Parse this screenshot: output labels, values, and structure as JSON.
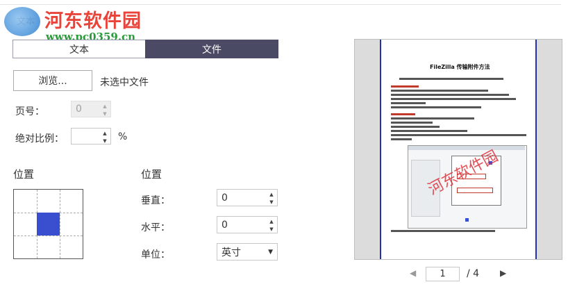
{
  "header": {
    "logo_name": "河东软件园",
    "logo_url": "www.pc0359.cn",
    "section_title": "文本"
  },
  "tabs": [
    {
      "label": "文本",
      "active": false
    },
    {
      "label": "文件",
      "active": true
    }
  ],
  "file": {
    "browse_label": "浏览...",
    "status": "未选中文件"
  },
  "page_number": {
    "label": "页号：",
    "value": "0",
    "disabled": true
  },
  "absolute_scale": {
    "label": "绝对比例：",
    "value": "",
    "unit": "%"
  },
  "position_grid": {
    "heading": "位置",
    "selected_cell": "center"
  },
  "position": {
    "heading": "位置",
    "vertical_label": "垂直：",
    "vertical_value": "0",
    "horizontal_label": "水平：",
    "horizontal_value": "0",
    "unit_label": "单位：",
    "unit_value": "英寸"
  },
  "preview": {
    "doc_title": "FileZilla 传输附件方法",
    "watermark_text": "河东软件园",
    "current_page": "1",
    "total_pages": "/ 4"
  },
  "colors": {
    "active_tab": "#4a4a64",
    "position_cell": "#3a4fd0",
    "preview_border": "#2233aa",
    "logo_red": "#e8443a",
    "logo_green": "#2a9b3a"
  }
}
